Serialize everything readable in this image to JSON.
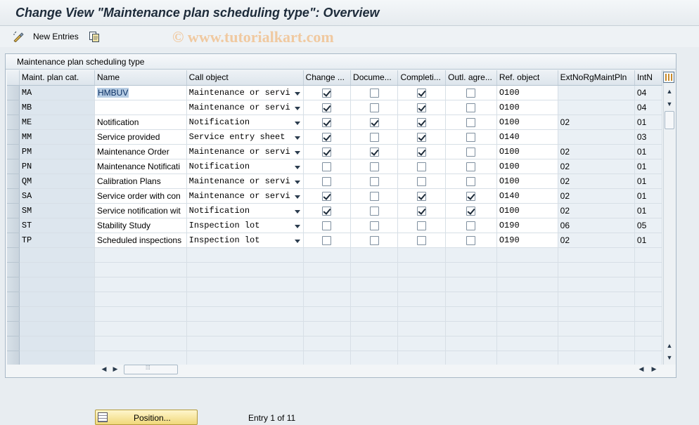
{
  "window": {
    "title": "Change View \"Maintenance plan scheduling type\": Overview"
  },
  "toolbar": {
    "new_entries_label": "New Entries",
    "watermark": "© www.tutorialkart.com"
  },
  "panel": {
    "title": "Maintenance plan scheduling type"
  },
  "table": {
    "headers": [
      "Maint. plan cat.",
      "Name",
      "Call object",
      "Change ...",
      "Docume...",
      "Completi...",
      "Outl. agre...",
      "Ref. object",
      "ExtNoRgMaintPln",
      "IntN"
    ],
    "rows": [
      {
        "cat": "MA",
        "name": "HMBUV",
        "call": "Maintenance or servi",
        "change": true,
        "docu": false,
        "compl": true,
        "outl": false,
        "ref": "O100",
        "ext": "",
        "int": "04"
      },
      {
        "cat": "MB",
        "name": "",
        "call": "Maintenance or servi",
        "change": true,
        "docu": false,
        "compl": true,
        "outl": false,
        "ref": "O100",
        "ext": "",
        "int": "04"
      },
      {
        "cat": "ME",
        "name": "Notification",
        "call": "Notification",
        "change": true,
        "docu": true,
        "compl": true,
        "outl": false,
        "ref": "O100",
        "ext": "02",
        "int": "01"
      },
      {
        "cat": "MM",
        "name": "Service provided",
        "call": "Service entry sheet",
        "change": true,
        "docu": false,
        "compl": true,
        "outl": false,
        "ref": "O140",
        "ext": "",
        "int": "03"
      },
      {
        "cat": "PM",
        "name": "Maintenance Order",
        "call": "Maintenance or servi",
        "change": true,
        "docu": true,
        "compl": true,
        "outl": false,
        "ref": "O100",
        "ext": "02",
        "int": "01"
      },
      {
        "cat": "PN",
        "name": "Maintenance Notificati",
        "call": "Notification",
        "change": false,
        "docu": false,
        "compl": false,
        "outl": false,
        "ref": "O100",
        "ext": "02",
        "int": "01"
      },
      {
        "cat": "QM",
        "name": "Calibration Plans",
        "call": "Maintenance or servi",
        "change": false,
        "docu": false,
        "compl": false,
        "outl": false,
        "ref": "O100",
        "ext": "02",
        "int": "01"
      },
      {
        "cat": "SA",
        "name": "Service order with con",
        "call": "Maintenance or servi",
        "change": true,
        "docu": false,
        "compl": true,
        "outl": true,
        "ref": "O140",
        "ext": "02",
        "int": "01"
      },
      {
        "cat": "SM",
        "name": "Service notification wit",
        "call": "Notification",
        "change": true,
        "docu": false,
        "compl": true,
        "outl": true,
        "ref": "O100",
        "ext": "02",
        "int": "01"
      },
      {
        "cat": "ST",
        "name": "Stability Study",
        "call": "Inspection lot",
        "change": false,
        "docu": false,
        "compl": false,
        "outl": false,
        "ref": "O190",
        "ext": "06",
        "int": "05"
      },
      {
        "cat": "TP",
        "name": "Scheduled inspections",
        "call": "Inspection lot",
        "change": false,
        "docu": false,
        "compl": false,
        "outl": false,
        "ref": "O190",
        "ext": "02",
        "int": "01"
      }
    ],
    "empty_rows": 8
  },
  "footer": {
    "position_label": "Position...",
    "entry_text": "Entry 1 of 11"
  }
}
